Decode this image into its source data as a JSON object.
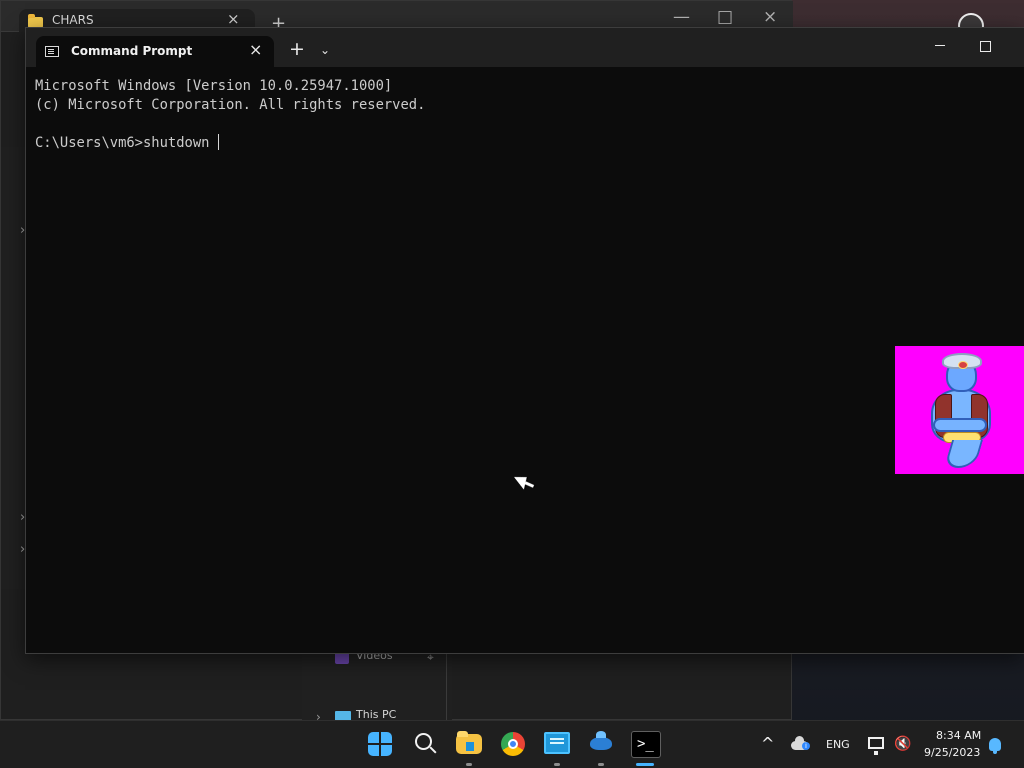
{
  "background_window": {
    "tab_title": "CHARS",
    "close_symbol": "×",
    "new_tab_symbol": "+",
    "minimize_symbol": "—",
    "maximize_symbol": "□",
    "close_window_symbol": "×",
    "side_chevron_symbol": "›",
    "navigation": {
      "videos_label": "Videos",
      "pin_symbol": "⌖",
      "this_pc_label": "This PC",
      "this_pc_chevron_symbol": "›"
    }
  },
  "terminal": {
    "tab_title": "Command Prompt",
    "close_symbol": "×",
    "new_tab_symbol": "+",
    "dropdown_symbol": "⌄",
    "output_lines": [
      "Microsoft Windows [Version 10.0.25947.1000]",
      "(c) Microsoft Corporation. All rights reserved."
    ],
    "prompt_line": "C:\\Users\\vm6>shutdown"
  },
  "taskbar": {
    "terminal_icon_glyph": ">_",
    "tray": {
      "overflow_symbol": "^",
      "language": "ENG",
      "volume_symbol": "🔇",
      "time": "8:34 AM",
      "date": "9/25/2023"
    }
  },
  "icons": {
    "background_explorer": "folder-icon",
    "command_prompt": "command-prompt-icon",
    "assistant": "genie-assistant-icon",
    "start": "windows-icon",
    "search": "search-icon",
    "file_explorer": "folder-icon",
    "chrome": "chrome-icon",
    "keyboard": "on-screen-keyboard-icon",
    "game": "game-icon",
    "terminal": "terminal-icon",
    "onedrive": "cloud-info-icon",
    "network": "network-icon",
    "volume": "volume-muted-icon",
    "notifications": "notification-bell-icon"
  },
  "colors": {
    "terminal_background": "#0c0c0c",
    "terminal_text": "#cccccc",
    "taskbar": "#1f1f1f",
    "accent": "#46b4ff",
    "assistant_background": "#ff00ff"
  }
}
